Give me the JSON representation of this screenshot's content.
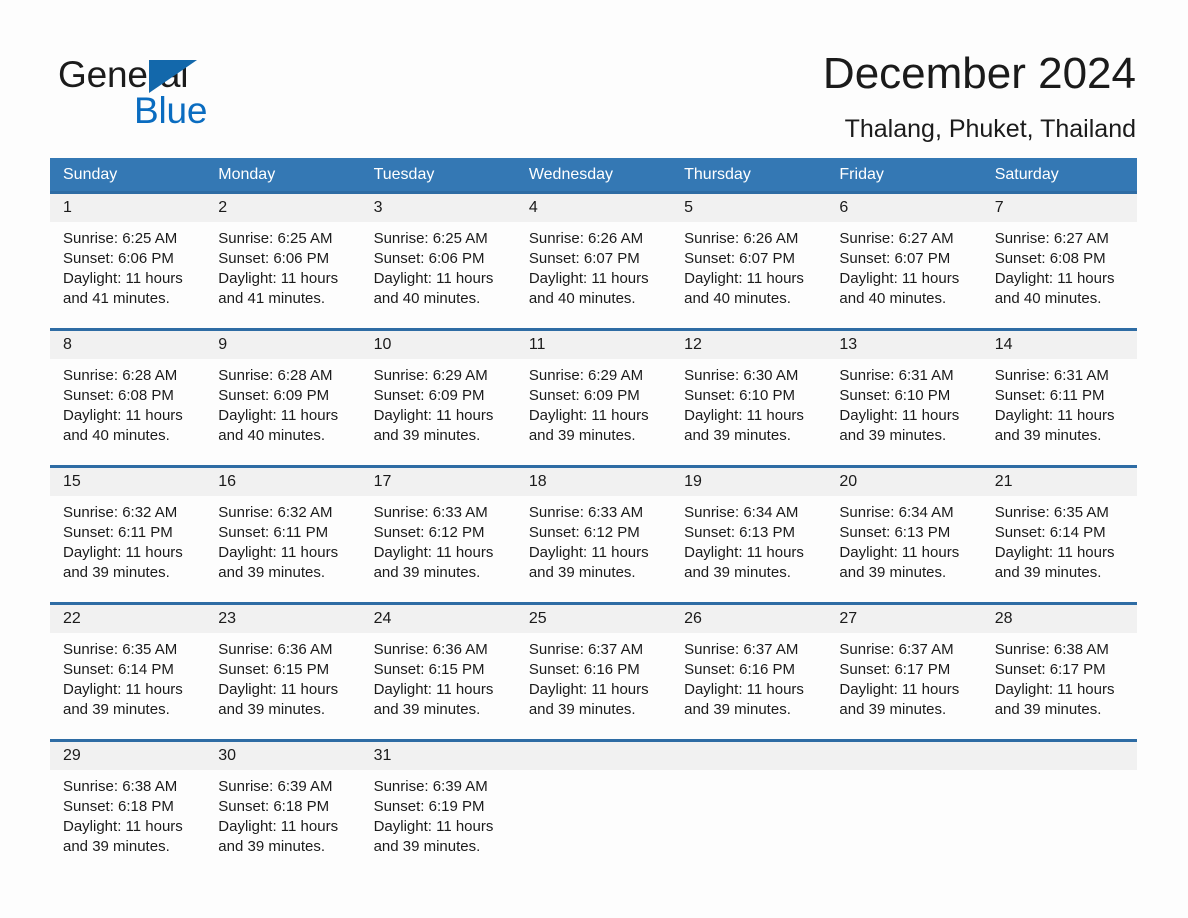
{
  "brand": {
    "name_part1": "General",
    "name_part2": "Blue",
    "triangle_color": "#1368ab",
    "blue_text_color": "#0a6cc0"
  },
  "header": {
    "month_title": "December 2024",
    "location": "Thalang, Phuket, Thailand"
  },
  "theme": {
    "header_row_bg": "#3478b4",
    "week_divider": "#2e6ca4",
    "date_band_bg": "#f1f1f1",
    "page_bg": "#fdfdfd",
    "text": "#1b1b1b"
  },
  "calendar": {
    "weekday_headers": [
      "Sunday",
      "Monday",
      "Tuesday",
      "Wednesday",
      "Thursday",
      "Friday",
      "Saturday"
    ],
    "weeks": [
      {
        "dates": [
          "1",
          "2",
          "3",
          "4",
          "5",
          "6",
          "7"
        ],
        "cells": [
          {
            "sunrise": "Sunrise: 6:25 AM",
            "sunset": "Sunset: 6:06 PM",
            "daylight1": "Daylight: 11 hours",
            "daylight2": "and 41 minutes."
          },
          {
            "sunrise": "Sunrise: 6:25 AM",
            "sunset": "Sunset: 6:06 PM",
            "daylight1": "Daylight: 11 hours",
            "daylight2": "and 41 minutes."
          },
          {
            "sunrise": "Sunrise: 6:25 AM",
            "sunset": "Sunset: 6:06 PM",
            "daylight1": "Daylight: 11 hours",
            "daylight2": "and 40 minutes."
          },
          {
            "sunrise": "Sunrise: 6:26 AM",
            "sunset": "Sunset: 6:07 PM",
            "daylight1": "Daylight: 11 hours",
            "daylight2": "and 40 minutes."
          },
          {
            "sunrise": "Sunrise: 6:26 AM",
            "sunset": "Sunset: 6:07 PM",
            "daylight1": "Daylight: 11 hours",
            "daylight2": "and 40 minutes."
          },
          {
            "sunrise": "Sunrise: 6:27 AM",
            "sunset": "Sunset: 6:07 PM",
            "daylight1": "Daylight: 11 hours",
            "daylight2": "and 40 minutes."
          },
          {
            "sunrise": "Sunrise: 6:27 AM",
            "sunset": "Sunset: 6:08 PM",
            "daylight1": "Daylight: 11 hours",
            "daylight2": "and 40 minutes."
          }
        ]
      },
      {
        "dates": [
          "8",
          "9",
          "10",
          "11",
          "12",
          "13",
          "14"
        ],
        "cells": [
          {
            "sunrise": "Sunrise: 6:28 AM",
            "sunset": "Sunset: 6:08 PM",
            "daylight1": "Daylight: 11 hours",
            "daylight2": "and 40 minutes."
          },
          {
            "sunrise": "Sunrise: 6:28 AM",
            "sunset": "Sunset: 6:09 PM",
            "daylight1": "Daylight: 11 hours",
            "daylight2": "and 40 minutes."
          },
          {
            "sunrise": "Sunrise: 6:29 AM",
            "sunset": "Sunset: 6:09 PM",
            "daylight1": "Daylight: 11 hours",
            "daylight2": "and 39 minutes."
          },
          {
            "sunrise": "Sunrise: 6:29 AM",
            "sunset": "Sunset: 6:09 PM",
            "daylight1": "Daylight: 11 hours",
            "daylight2": "and 39 minutes."
          },
          {
            "sunrise": "Sunrise: 6:30 AM",
            "sunset": "Sunset: 6:10 PM",
            "daylight1": "Daylight: 11 hours",
            "daylight2": "and 39 minutes."
          },
          {
            "sunrise": "Sunrise: 6:31 AM",
            "sunset": "Sunset: 6:10 PM",
            "daylight1": "Daylight: 11 hours",
            "daylight2": "and 39 minutes."
          },
          {
            "sunrise": "Sunrise: 6:31 AM",
            "sunset": "Sunset: 6:11 PM",
            "daylight1": "Daylight: 11 hours",
            "daylight2": "and 39 minutes."
          }
        ]
      },
      {
        "dates": [
          "15",
          "16",
          "17",
          "18",
          "19",
          "20",
          "21"
        ],
        "cells": [
          {
            "sunrise": "Sunrise: 6:32 AM",
            "sunset": "Sunset: 6:11 PM",
            "daylight1": "Daylight: 11 hours",
            "daylight2": "and 39 minutes."
          },
          {
            "sunrise": "Sunrise: 6:32 AM",
            "sunset": "Sunset: 6:11 PM",
            "daylight1": "Daylight: 11 hours",
            "daylight2": "and 39 minutes."
          },
          {
            "sunrise": "Sunrise: 6:33 AM",
            "sunset": "Sunset: 6:12 PM",
            "daylight1": "Daylight: 11 hours",
            "daylight2": "and 39 minutes."
          },
          {
            "sunrise": "Sunrise: 6:33 AM",
            "sunset": "Sunset: 6:12 PM",
            "daylight1": "Daylight: 11 hours",
            "daylight2": "and 39 minutes."
          },
          {
            "sunrise": "Sunrise: 6:34 AM",
            "sunset": "Sunset: 6:13 PM",
            "daylight1": "Daylight: 11 hours",
            "daylight2": "and 39 minutes."
          },
          {
            "sunrise": "Sunrise: 6:34 AM",
            "sunset": "Sunset: 6:13 PM",
            "daylight1": "Daylight: 11 hours",
            "daylight2": "and 39 minutes."
          },
          {
            "sunrise": "Sunrise: 6:35 AM",
            "sunset": "Sunset: 6:14 PM",
            "daylight1": "Daylight: 11 hours",
            "daylight2": "and 39 minutes."
          }
        ]
      },
      {
        "dates": [
          "22",
          "23",
          "24",
          "25",
          "26",
          "27",
          "28"
        ],
        "cells": [
          {
            "sunrise": "Sunrise: 6:35 AM",
            "sunset": "Sunset: 6:14 PM",
            "daylight1": "Daylight: 11 hours",
            "daylight2": "and 39 minutes."
          },
          {
            "sunrise": "Sunrise: 6:36 AM",
            "sunset": "Sunset: 6:15 PM",
            "daylight1": "Daylight: 11 hours",
            "daylight2": "and 39 minutes."
          },
          {
            "sunrise": "Sunrise: 6:36 AM",
            "sunset": "Sunset: 6:15 PM",
            "daylight1": "Daylight: 11 hours",
            "daylight2": "and 39 minutes."
          },
          {
            "sunrise": "Sunrise: 6:37 AM",
            "sunset": "Sunset: 6:16 PM",
            "daylight1": "Daylight: 11 hours",
            "daylight2": "and 39 minutes."
          },
          {
            "sunrise": "Sunrise: 6:37 AM",
            "sunset": "Sunset: 6:16 PM",
            "daylight1": "Daylight: 11 hours",
            "daylight2": "and 39 minutes."
          },
          {
            "sunrise": "Sunrise: 6:37 AM",
            "sunset": "Sunset: 6:17 PM",
            "daylight1": "Daylight: 11 hours",
            "daylight2": "and 39 minutes."
          },
          {
            "sunrise": "Sunrise: 6:38 AM",
            "sunset": "Sunset: 6:17 PM",
            "daylight1": "Daylight: 11 hours",
            "daylight2": "and 39 minutes."
          }
        ]
      },
      {
        "dates": [
          "29",
          "30",
          "31",
          "",
          "",
          "",
          ""
        ],
        "cells": [
          {
            "sunrise": "Sunrise: 6:38 AM",
            "sunset": "Sunset: 6:18 PM",
            "daylight1": "Daylight: 11 hours",
            "daylight2": "and 39 minutes."
          },
          {
            "sunrise": "Sunrise: 6:39 AM",
            "sunset": "Sunset: 6:18 PM",
            "daylight1": "Daylight: 11 hours",
            "daylight2": "and 39 minutes."
          },
          {
            "sunrise": "Sunrise: 6:39 AM",
            "sunset": "Sunset: 6:19 PM",
            "daylight1": "Daylight: 11 hours",
            "daylight2": "and 39 minutes."
          },
          {
            "sunrise": "",
            "sunset": "",
            "daylight1": "",
            "daylight2": ""
          },
          {
            "sunrise": "",
            "sunset": "",
            "daylight1": "",
            "daylight2": ""
          },
          {
            "sunrise": "",
            "sunset": "",
            "daylight1": "",
            "daylight2": ""
          },
          {
            "sunrise": "",
            "sunset": "",
            "daylight1": "",
            "daylight2": ""
          }
        ]
      }
    ]
  }
}
